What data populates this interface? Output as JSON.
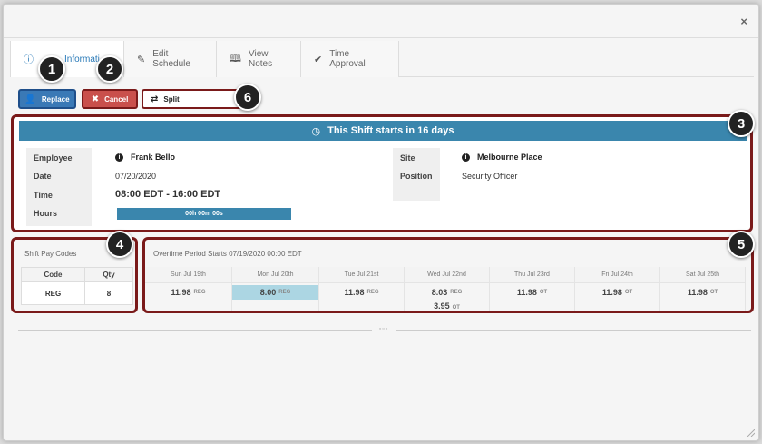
{
  "window": {
    "close_label": "×"
  },
  "tabs": [
    {
      "label": "Informati",
      "icon": "info-icon",
      "active": true
    },
    {
      "label": "Edit Schedule",
      "icon": "pencil-icon"
    },
    {
      "label": "View Notes",
      "icon": "book-icon"
    },
    {
      "label": "Time Approval",
      "icon": "check-icon"
    }
  ],
  "actions": {
    "replace_label": "Replace",
    "cancel_label": "Cancel",
    "split_label": "Split"
  },
  "badges": [
    "1",
    "2",
    "3",
    "4",
    "5",
    "6"
  ],
  "shift": {
    "banner": "This Shift starts in 16 days",
    "labels": {
      "employee": "Employee",
      "date": "Date",
      "time": "Time",
      "hours": "Hours",
      "site": "Site",
      "position": "Position"
    },
    "employee": "Frank Bello",
    "date": "07/20/2020",
    "time": "08:00 EDT - 16:00 EDT",
    "hours": "00h 00m 00s",
    "site": "Melbourne Place",
    "position": "Security Officer"
  },
  "pay_codes": {
    "title": "Shift Pay Codes",
    "headers": {
      "code": "Code",
      "qty": "Qty"
    },
    "rows": [
      {
        "code": "REG",
        "qty": "8"
      }
    ]
  },
  "overtime": {
    "title": "Overtime Period Starts 07/19/2020 00:00 EDT",
    "days": [
      {
        "label": "Sun Jul 19th",
        "value": "11.98",
        "tag": "REG"
      },
      {
        "label": "Mon Jul 20th",
        "value": "8.00",
        "tag": "REG",
        "highlight": true
      },
      {
        "label": "Tue Jul 21st",
        "value": "11.98",
        "tag": "REG"
      },
      {
        "label": "Wed Jul 22nd",
        "value": "8.03",
        "tag": "REG",
        "value2": "3.95",
        "tag2": "OT"
      },
      {
        "label": "Thu Jul 23rd",
        "value": "11.98",
        "tag": "OT"
      },
      {
        "label": "Fri Jul 24th",
        "value": "11.98",
        "tag": "OT"
      },
      {
        "label": "Sat Jul 25th",
        "value": "11.98",
        "tag": "OT"
      }
    ]
  },
  "colors": {
    "primary": "#3a79b6",
    "danger": "#c9504c",
    "banner": "#3a86ad",
    "callout": "#7a1a1a",
    "highlight": "#acd6e3"
  }
}
